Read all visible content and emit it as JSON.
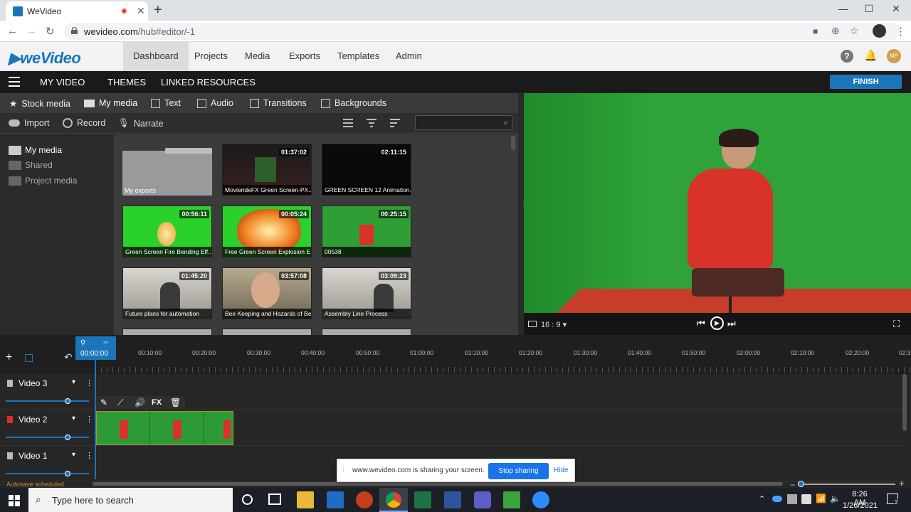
{
  "browser": {
    "tab_title": "WeVideo",
    "url_host": "wevideo.com",
    "url_path": "/hub#editor/-1"
  },
  "app": {
    "logo": "weVideo",
    "nav": [
      "Dashboard",
      "Projects",
      "Media",
      "Exports",
      "Templates",
      "Admin"
    ],
    "active_nav": "Dashboard",
    "avatar_initials": "MP"
  },
  "editor_bar": {
    "items": [
      "MY VIDEO",
      "THEMES",
      "LINKED RESOURCES"
    ],
    "finish": "FINISH"
  },
  "media_tabs": [
    "Stock media",
    "My media",
    "Text",
    "Audio",
    "Transitions",
    "Backgrounds"
  ],
  "media_tools": [
    "Import",
    "Record",
    "Narrate"
  ],
  "left_nav": [
    "My media",
    "Shared",
    "Project media"
  ],
  "media_items": [
    {
      "caption": "My exports",
      "duration": "",
      "kind": "folder"
    },
    {
      "caption": "MovierideFX Green Screen-PX...",
      "duration": "01:37:02",
      "kind": "dark"
    },
    {
      "caption": "GREEN SCREEN 12 Animation...",
      "duration": "02:11:15",
      "kind": "black"
    },
    {
      "caption": "Green Screen Fire Bending Eff...",
      "duration": "00:56:11",
      "kind": "fire"
    },
    {
      "caption": "Free Green Screen Explosion E...",
      "duration": "00:05:24",
      "kind": "explosion"
    },
    {
      "caption": "00538",
      "duration": "00:25:15",
      "kind": "person"
    },
    {
      "caption": "Future plans for automation",
      "duration": "01:45:20",
      "kind": "office"
    },
    {
      "caption": "Bee Keeping and Hazards of Be...",
      "duration": "03:57:08",
      "kind": "face"
    },
    {
      "caption": "Assembly Line Process",
      "duration": "03:09:23",
      "kind": "office"
    }
  ],
  "preview": {
    "aspect": "16 : 9"
  },
  "timeline": {
    "playhead_time": "00:00:00",
    "ticks": [
      "00:10:00",
      "00:20:00",
      "00:30:00",
      "00:40:00",
      "00:50:00",
      "01:00:00",
      "01:10:00",
      "01:20:00",
      "01:30:00",
      "01:40:00",
      "01:50:00",
      "02:00:00",
      "02:10:00",
      "02:20:00",
      "02:3"
    ],
    "tracks": [
      "Video 3",
      "Video 2",
      "Video 1"
    ],
    "clip_tool_fx": "FX",
    "autosave": "Autosave scheduled."
  },
  "share_bar": {
    "message": "www.wevideo.com is sharing your screen.",
    "stop": "Stop sharing",
    "hide": "Hide"
  },
  "taskbar": {
    "search_placeholder": "Type here to search",
    "time": "8:26 AM",
    "date": "1/26/2021",
    "notif_count": "2"
  },
  "colors": {
    "brand": "#1b75bb",
    "green_screen": "#2fa33a",
    "jacket": "#d8322a"
  }
}
